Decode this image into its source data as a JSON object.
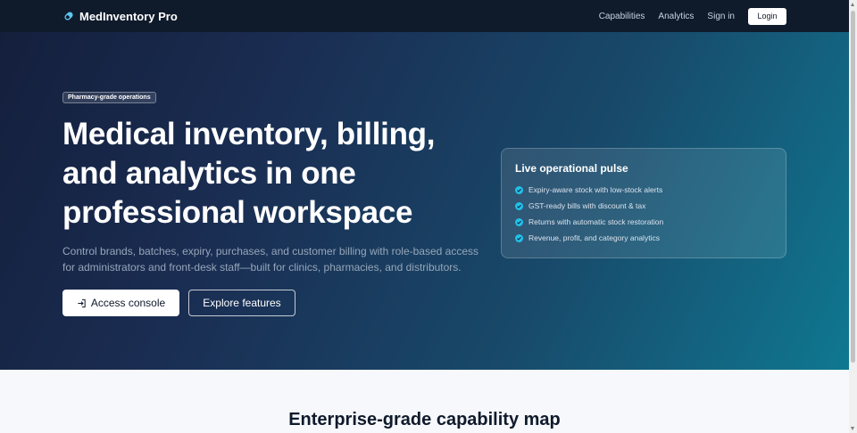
{
  "nav": {
    "brand": "MedInventory Pro",
    "brand_icon": "pill-capsule-icon",
    "links": [
      "Capabilities",
      "Analytics",
      "Sign in"
    ],
    "login_label": "Login"
  },
  "hero": {
    "badge": "Pharmacy-grade operations",
    "headline": "Medical inventory, billing, and analytics in one professional workspace",
    "subtext": "Control brands, batches, expiry, purchases, and customer billing with role-based access for administrators and front-desk staff—built for clinics, pharmacies, and distributors.",
    "primary_button": "Access console",
    "primary_button_icon": "login-arrow-icon",
    "secondary_button": "Explore features"
  },
  "pulse": {
    "title": "Live operational pulse",
    "items": [
      "Expiry-aware stock with low-stock alerts",
      "GST-ready bills with discount & tax",
      "Returns with automatic stock restoration",
      "Revenue, profit, and category analytics"
    ],
    "item_icon": "check-circle-icon",
    "accent_color": "#22c0e8"
  },
  "section": {
    "title": "Enterprise-grade capability map"
  },
  "colors": {
    "nav_bg": "#0f1a2b",
    "hero_gradient_start": "#141f3c",
    "hero_gradient_end": "#0f7891",
    "page_bg": "#f6f8fb"
  }
}
